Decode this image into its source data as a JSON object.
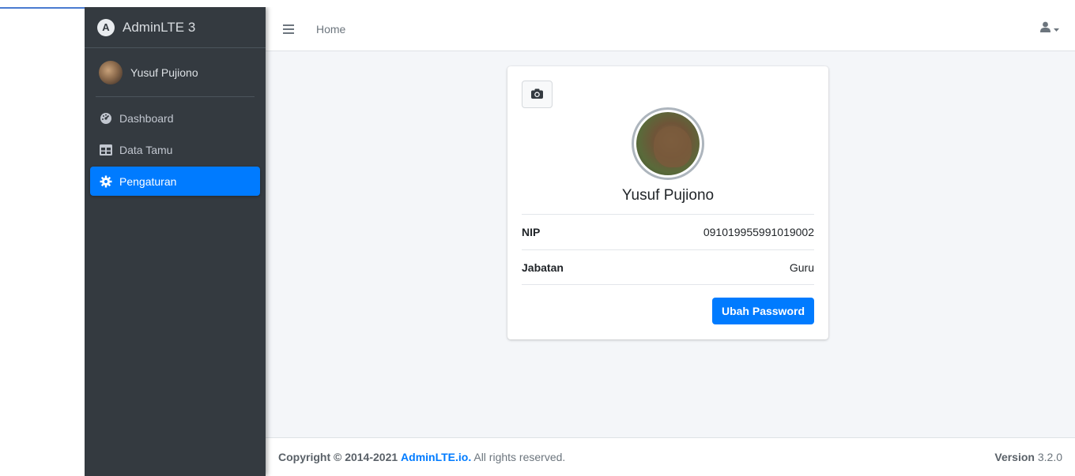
{
  "brand": {
    "title": "AdminLTE 3",
    "logo_letter": "A"
  },
  "user": {
    "name": "Yusuf Pujiono"
  },
  "sidebar": {
    "items": [
      {
        "label": "Dashboard",
        "icon": "dashboard-gauge-icon",
        "active": false
      },
      {
        "label": "Data Tamu",
        "icon": "table-icon",
        "active": false
      },
      {
        "label": "Pengaturan",
        "icon": "gear-icon",
        "active": true
      }
    ]
  },
  "topbar": {
    "home_label": "Home",
    "user_menu_icon": "user-icon"
  },
  "profile": {
    "name": "Yusuf Pujiono",
    "fields": [
      {
        "key": "NIP",
        "value": "091019955991019002"
      },
      {
        "key": "Jabatan",
        "value": "Guru"
      }
    ],
    "button_label": "Ubah Password",
    "camera_icon": "camera-icon"
  },
  "footer": {
    "copyright_prefix": "Copyright © 2014-2021",
    "link_text": "AdminLTE.io.",
    "suffix": "All rights reserved.",
    "version_label": "Version",
    "version_number": "3.2.0"
  },
  "colors": {
    "sidebar_bg": "#343a40",
    "accent": "#007bff",
    "content_bg": "#f4f6f9"
  }
}
